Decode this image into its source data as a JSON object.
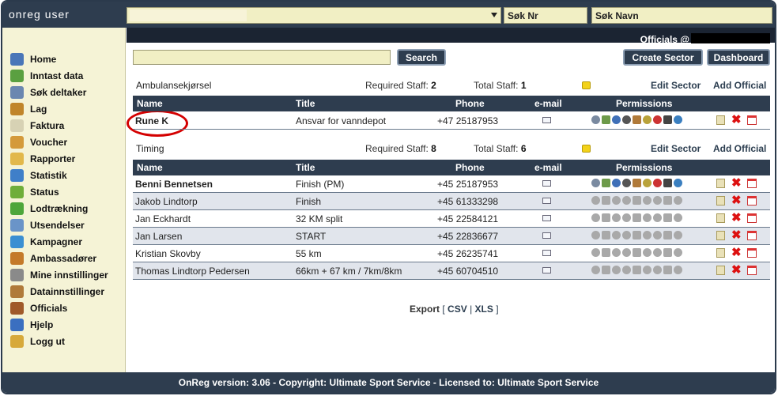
{
  "app": {
    "brand": "onreg user"
  },
  "top_search": {
    "nr_label": "Søk Nr",
    "name_label": "Søk Navn"
  },
  "header": {
    "title": "Officials @"
  },
  "buttons": {
    "search": "Search",
    "create_sector": "Create Sector",
    "dashboard": "Dashboard"
  },
  "sidebar": {
    "items": [
      {
        "label": "Home",
        "icon": "home-icon",
        "color": "#4a76b8"
      },
      {
        "label": "Inntast data",
        "icon": "add-user-icon",
        "color": "#5aa040"
      },
      {
        "label": "Søk deltaker",
        "icon": "search-user-icon",
        "color": "#6b87b0"
      },
      {
        "label": "Lag",
        "icon": "team-icon",
        "color": "#c0852a"
      },
      {
        "label": "Faktura",
        "icon": "invoice-icon",
        "color": "#d7d2b4"
      },
      {
        "label": "Voucher",
        "icon": "gift-icon",
        "color": "#d49a3a"
      },
      {
        "label": "Rapporter",
        "icon": "folder-icon",
        "color": "#e2b84a"
      },
      {
        "label": "Statistik",
        "icon": "chart-icon",
        "color": "#3f7fc9"
      },
      {
        "label": "Status",
        "icon": "status-icon",
        "color": "#6fae3a"
      },
      {
        "label": "Lodtrækning",
        "icon": "shuffle-icon",
        "color": "#4ea63a"
      },
      {
        "label": "Utsendelser",
        "icon": "mail-icon",
        "color": "#6a94c8"
      },
      {
        "label": "Kampagner",
        "icon": "globe-icon",
        "color": "#3b8fd2"
      },
      {
        "label": "Ambassadører",
        "icon": "ambassador-icon",
        "color": "#c47a2a"
      },
      {
        "label": "Mine innstillinger",
        "icon": "gear-icon",
        "color": "#8a8a8a"
      },
      {
        "label": "Datainnstillinger",
        "icon": "tools-icon",
        "color": "#b07a3a"
      },
      {
        "label": "Officials",
        "icon": "officials-icon",
        "color": "#a05a2a"
      },
      {
        "label": "Hjelp",
        "icon": "help-icon",
        "color": "#3a6fc0"
      },
      {
        "label": "Logg ut",
        "icon": "lock-icon",
        "color": "#d7a93a"
      }
    ]
  },
  "sectors": [
    {
      "name": "Ambulansekjørsel",
      "required_label": "Required Staff:",
      "required": "2",
      "total_label": "Total Staff:",
      "total": "1",
      "edit": "Edit Sector",
      "add": "Add Official",
      "rows": [
        {
          "name": "Rune K",
          "title": "Ansvar for vanndepot",
          "phone": "+47 25187953",
          "bold": true
        }
      ]
    },
    {
      "name": "Timing",
      "required_label": "Required Staff:",
      "required": "8",
      "total_label": "Total Staff:",
      "total": "6",
      "edit": "Edit Sector",
      "add": "Add Official",
      "rows": [
        {
          "name": "Benni Bennetsen",
          "title": "Finish (PM)",
          "phone": "+45 25187953",
          "bold": true
        },
        {
          "name": "Jakob Lindtorp",
          "title": "Finish",
          "phone": "+45 61333298",
          "bold": false
        },
        {
          "name": "Jan Eckhardt",
          "title": "32 KM split",
          "phone": "+45 22584121",
          "bold": false
        },
        {
          "name": "Jan Larsen",
          "title": "START",
          "phone": "+45 22836677",
          "bold": false
        },
        {
          "name": "Kristian Skovby",
          "title": "55 km",
          "phone": "+45 26235741",
          "bold": false
        },
        {
          "name": "Thomas Lindtorp Pedersen",
          "title": "66km + 67 km / 7km/8km",
          "phone": "+45 60704510",
          "bold": false
        }
      ]
    }
  ],
  "table_headers": {
    "name": "Name",
    "title": "Title",
    "phone": "Phone",
    "email": "e-mail",
    "permissions": "Permissions"
  },
  "export": {
    "label": "Export",
    "open": "[",
    "csv": "CSV",
    "sep": "|",
    "xls": "XLS",
    "close": "]"
  },
  "footer": {
    "text": "OnReg version: 3.06 - Copyright: Ultimate Sport Service - Licensed to: Ultimate Sport Service"
  }
}
